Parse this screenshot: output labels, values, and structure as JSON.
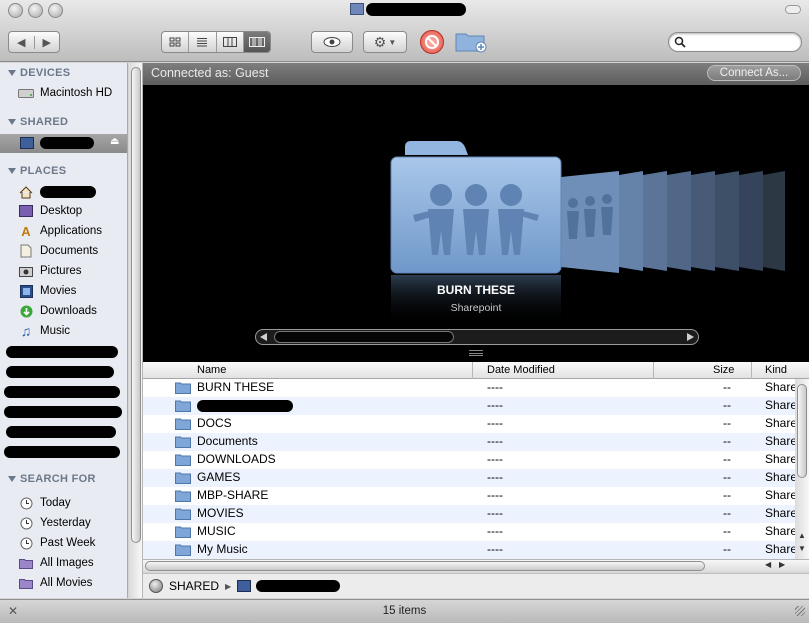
{
  "window": {
    "title_redacted": true
  },
  "toolbar": {
    "back_icon": "back-arrow-icon",
    "forward_icon": "forward-arrow-icon",
    "view_modes": [
      "icon-view",
      "list-view",
      "column-view",
      "cover-flow-view"
    ],
    "active_view": "cover-flow-view",
    "search_placeholder": ""
  },
  "sidebar": {
    "devices_header": "DEVICES",
    "devices": [
      {
        "label": "Macintosh HD",
        "icon": "hard-drive-icon"
      }
    ],
    "shared_header": "SHARED",
    "places_header": "PLACES",
    "places": [
      {
        "label": "Desktop",
        "icon": "desktop-icon"
      },
      {
        "label": "Applications",
        "icon": "applications-icon"
      },
      {
        "label": "Documents",
        "icon": "documents-icon"
      },
      {
        "label": "Pictures",
        "icon": "pictures-icon"
      },
      {
        "label": "Movies",
        "icon": "movies-icon"
      },
      {
        "label": "Downloads",
        "icon": "downloads-icon"
      },
      {
        "label": "Music",
        "icon": "music-icon"
      }
    ],
    "search_header": "SEARCH FOR",
    "searches": [
      {
        "label": "Today",
        "icon": "clock-icon"
      },
      {
        "label": "Yesterday",
        "icon": "clock-icon"
      },
      {
        "label": "Past Week",
        "icon": "clock-icon"
      },
      {
        "label": "All Images",
        "icon": "smart-folder-icon"
      },
      {
        "label": "All Movies",
        "icon": "smart-folder-icon"
      }
    ]
  },
  "server": {
    "connected_label": "Connected as: Guest",
    "connect_as_button": "Connect As..."
  },
  "coverflow": {
    "selected_name": "BURN THESE",
    "selected_kind": "Sharepoint"
  },
  "list": {
    "columns": {
      "name": "Name",
      "date": "Date Modified",
      "size": "Size",
      "kind": "Kind"
    },
    "rows": [
      {
        "name": "BURN THESE",
        "date": "----",
        "size": "--",
        "kind": "Share"
      },
      {
        "name": "",
        "date": "----",
        "size": "--",
        "kind": "Share"
      },
      {
        "name": "DOCS",
        "date": "----",
        "size": "--",
        "kind": "Share"
      },
      {
        "name": "Documents",
        "date": "----",
        "size": "--",
        "kind": "Share"
      },
      {
        "name": "DOWNLOADS",
        "date": "----",
        "size": "--",
        "kind": "Share"
      },
      {
        "name": "GAMES",
        "date": "----",
        "size": "--",
        "kind": "Share"
      },
      {
        "name": "MBP-SHARE",
        "date": "----",
        "size": "--",
        "kind": "Share"
      },
      {
        "name": "MOVIES",
        "date": "----",
        "size": "--",
        "kind": "Share"
      },
      {
        "name": "MUSIC",
        "date": "----",
        "size": "--",
        "kind": "Share"
      },
      {
        "name": "My Music",
        "date": "----",
        "size": "--",
        "kind": "Share"
      }
    ]
  },
  "pathbar": {
    "root": "SHARED"
  },
  "status": {
    "text": "15 items"
  }
}
